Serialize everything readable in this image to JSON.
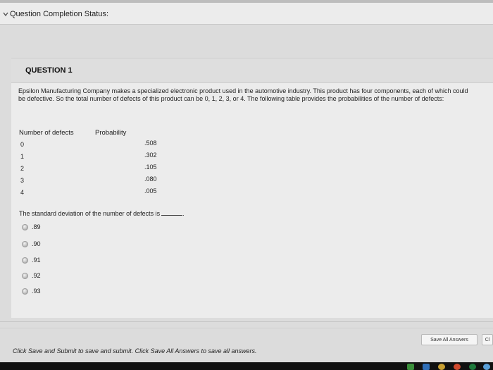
{
  "status": {
    "label": "Question Completion Status:"
  },
  "question": {
    "title": "QUESTION 1",
    "stem": "Epsilon Manufacturing Company makes a specialized electronic product used in the automotive industry. This product has four components, each of which could be defective. So the total number of defects of this product can be 0, 1, 2, 3, or 4. The following table provides the probabilities of the number of defects:",
    "table": {
      "headers": [
        "Number of defects",
        "Probability"
      ],
      "rows": [
        {
          "defects": "0",
          "probability": ".508"
        },
        {
          "defects": "1",
          "probability": ".302"
        },
        {
          "defects": "2",
          "probability": ".105"
        },
        {
          "defects": "3",
          "probability": ".080"
        },
        {
          "defects": "4",
          "probability": ".005"
        }
      ]
    },
    "prompt": "The standard deviation of the number of defects is",
    "prompt_end": ".",
    "options": [
      ".89",
      ".90",
      ".91",
      ".92",
      ".93"
    ]
  },
  "footer": {
    "save_all_label": "Save All Answers",
    "save_submit_label": "Cl",
    "note": "Click Save and Submit to save and submit. Click Save All Answers to save all answers."
  },
  "colors": {
    "background": "#dcdcdc",
    "panel": "#ececec",
    "taskbar": "#111111"
  }
}
